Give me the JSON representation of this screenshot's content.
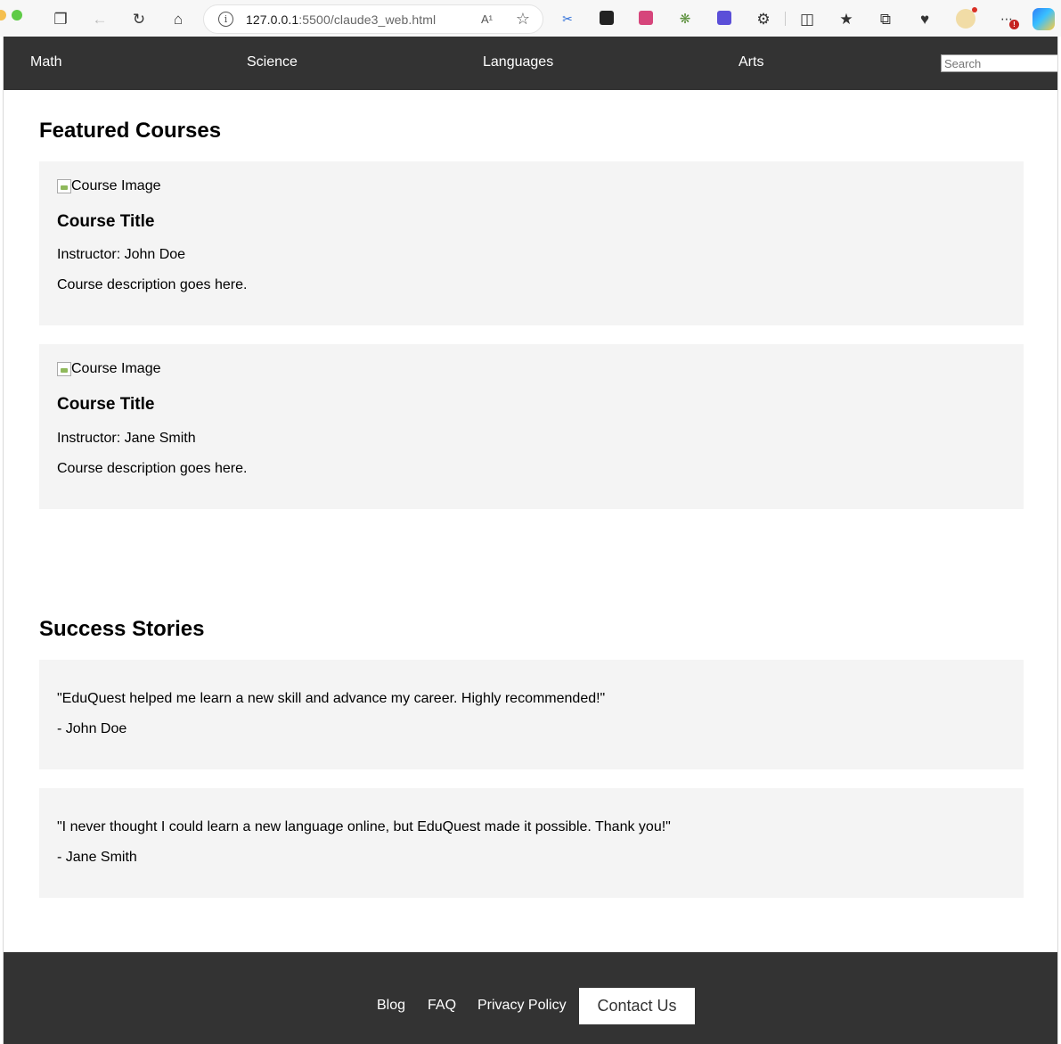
{
  "browser": {
    "url_host": "127.0.0.1",
    "url_rest": ":5500/claude3_web.html",
    "read_aloud": "A¹",
    "badge_count": "!"
  },
  "nav": {
    "items": [
      "Math",
      "Science",
      "Languages",
      "Arts"
    ],
    "search_placeholder": "Search"
  },
  "featured": {
    "title": "Featured Courses",
    "courses": [
      {
        "image_alt": "Course Image",
        "title": "Course Title",
        "instructor": "Instructor: John Doe",
        "description": "Course description goes here."
      },
      {
        "image_alt": "Course Image",
        "title": "Course Title",
        "instructor": "Instructor: Jane Smith",
        "description": "Course description goes here."
      }
    ]
  },
  "stories": {
    "title": "Success Stories",
    "items": [
      {
        "quote": "\"EduQuest helped me learn a new skill and advance my career. Highly recommended!\"",
        "author": "- John Doe"
      },
      {
        "quote": "\"I never thought I could learn a new language online, but EduQuest made it possible. Thank you!\"",
        "author": "- Jane Smith"
      }
    ]
  },
  "footer": {
    "links": [
      "Blog",
      "FAQ",
      "Privacy Policy"
    ],
    "contact_label": "Contact Us"
  },
  "colors": {
    "nav_bg": "#333333",
    "card_bg": "#f4f4f4",
    "page_bg": "#ffffff"
  }
}
